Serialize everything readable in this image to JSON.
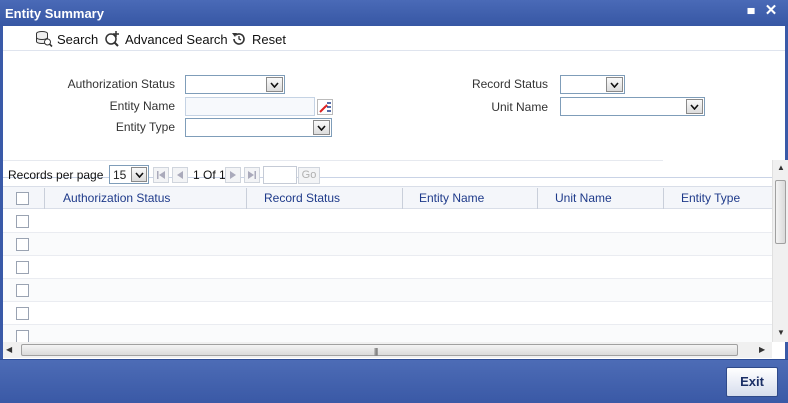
{
  "window": {
    "title": "Entity Summary",
    "minimize_glyph": "▄",
    "close_glyph": "✕"
  },
  "toolbar": {
    "search_label": "Search",
    "advanced_search_label": "Advanced Search",
    "reset_label": "Reset"
  },
  "criteria": {
    "authorization_status_label": "Authorization Status",
    "entity_name_label": "Entity Name",
    "entity_type_label": "Entity Type",
    "record_status_label": "Record Status",
    "unit_name_label": "Unit Name"
  },
  "pager": {
    "records_per_page_label": "Records per page",
    "records_per_page_value": "15",
    "page_info": "1 Of 1",
    "go_label": "Go"
  },
  "grid": {
    "columns": [
      "Authorization Status",
      "Record Status",
      "Entity Name",
      "Unit Name",
      "Entity Type"
    ],
    "empty_row_count": 6
  },
  "footer": {
    "exit_label": "Exit"
  },
  "colors": {
    "titlebar": "#3d5da8",
    "header_text": "#1e3a8a",
    "footer": "#4463ad"
  }
}
